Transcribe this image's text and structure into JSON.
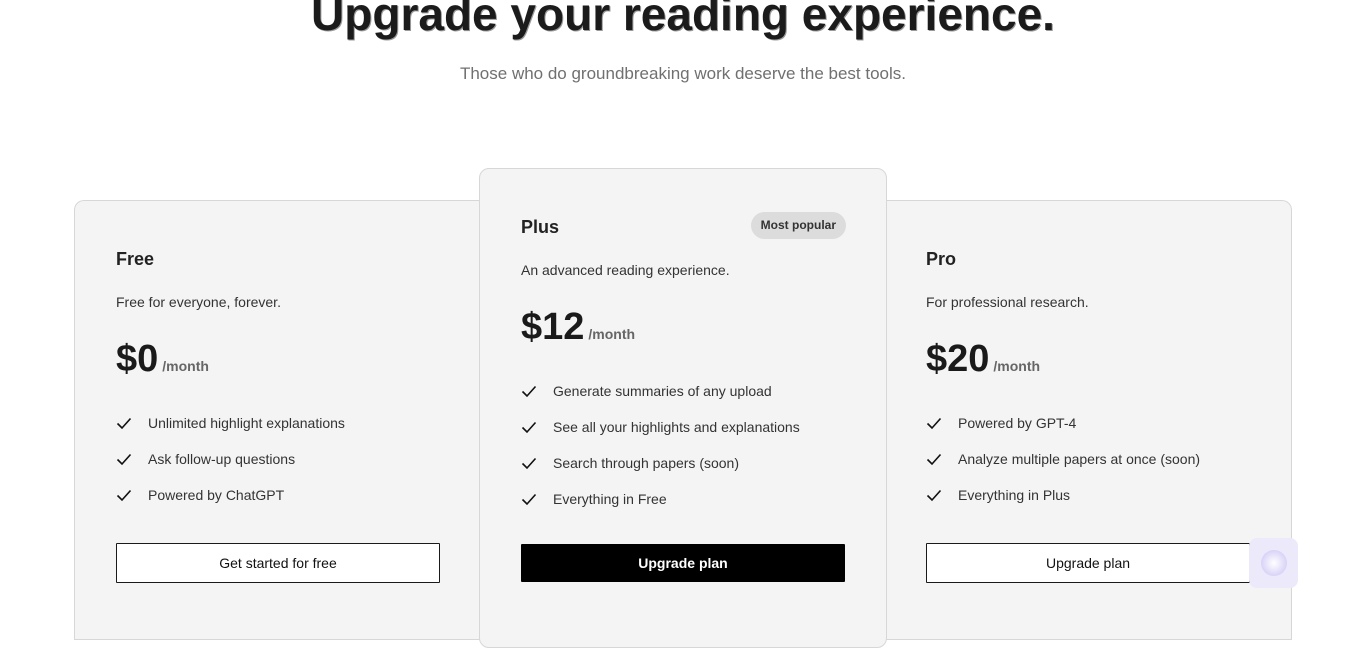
{
  "header": {
    "title": "Upgrade your reading experience.",
    "subtitle": "Those who do groundbreaking work deserve the best tools."
  },
  "plans": [
    {
      "name": "Free",
      "description": "Free for everyone, forever.",
      "price": "$0",
      "period": "/month",
      "features": [
        "Unlimited highlight explanations",
        "Ask follow-up questions",
        "Powered by ChatGPT"
      ],
      "cta": "Get started for free"
    },
    {
      "name": "Plus",
      "badge": "Most popular",
      "description": "An advanced reading experience.",
      "price": "$12",
      "period": "/month",
      "features": [
        "Generate summaries of any upload",
        "See all your highlights and explanations",
        "Search through papers (soon)",
        "Everything in Free"
      ],
      "cta": "Upgrade plan"
    },
    {
      "name": "Pro",
      "description": "For professional research.",
      "price": "$20",
      "period": "/month",
      "features": [
        "Powered by GPT-4",
        "Analyze multiple papers at once (soon)",
        "Everything in Plus"
      ],
      "cta": "Upgrade plan"
    }
  ],
  "icons": {
    "feature_check": "check-icon",
    "chat_widget": "chat-widget-icon"
  },
  "colors": {
    "card_bg": "#f4f4f4",
    "primary_button": "#000000",
    "badge_bg": "#dcdcdc",
    "widget_bg": "#ece9fb"
  }
}
